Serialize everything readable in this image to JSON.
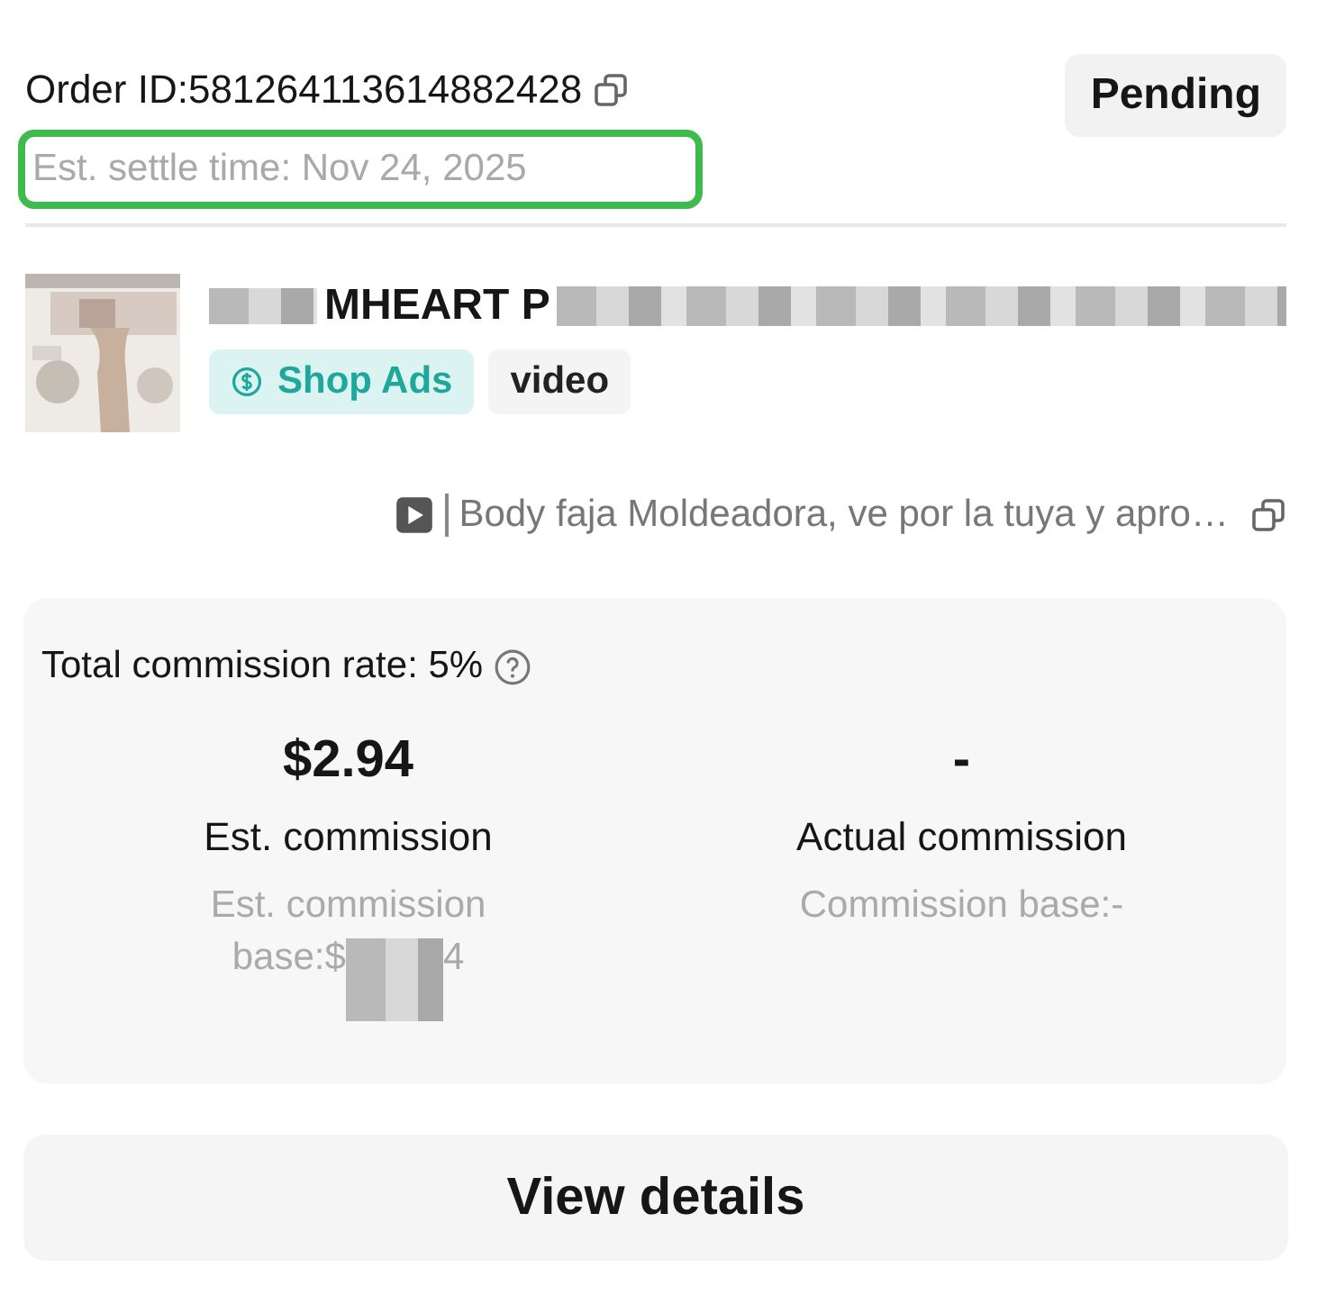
{
  "order": {
    "id_text": "Order ID:581264113614882428",
    "status": "Pending",
    "settle_time": "Est. settle time: Nov 24, 2025",
    "highlighted": true
  },
  "product": {
    "title_visible": "MHEART P",
    "tags": [
      {
        "label": "Shop Ads",
        "kind": "ads"
      },
      {
        "label": "video",
        "kind": "plain"
      }
    ]
  },
  "video_link": {
    "title": "Body faja Moldeadora, ve por la tuya y apro…"
  },
  "commission": {
    "rate": "Total commission rate: 5%",
    "columns": [
      {
        "value": "$2.94",
        "label": "Est. commission",
        "base": "Est. commission",
        "base_2": "base:$",
        "base_tail": "4"
      },
      {
        "value": "-",
        "label": "Actual commission",
        "base": "Commission base:-"
      }
    ]
  },
  "button": "View details"
}
